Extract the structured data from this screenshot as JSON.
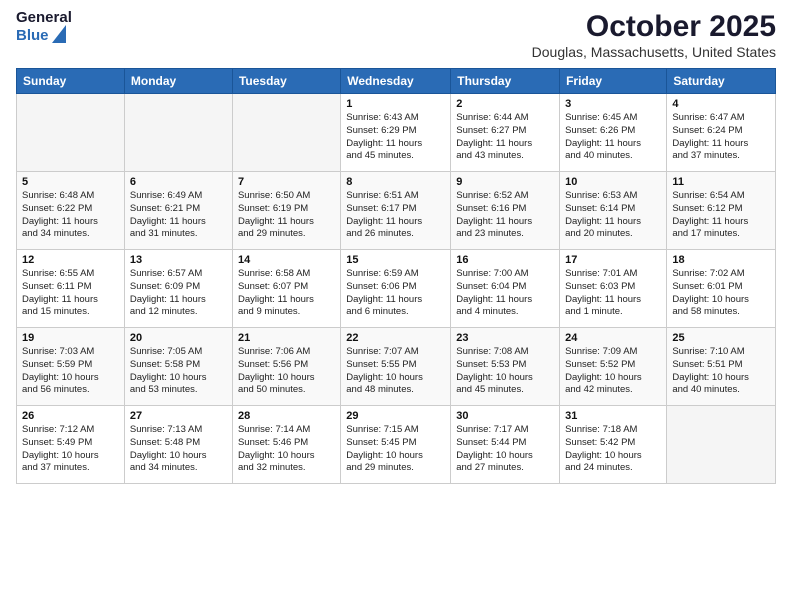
{
  "header": {
    "logo": {
      "general": "General",
      "blue": "Blue"
    },
    "title": "October 2025",
    "subtitle": "Douglas, Massachusetts, United States"
  },
  "weekdays": [
    "Sunday",
    "Monday",
    "Tuesday",
    "Wednesday",
    "Thursday",
    "Friday",
    "Saturday"
  ],
  "weeks": [
    [
      {
        "day": "",
        "info": ""
      },
      {
        "day": "",
        "info": ""
      },
      {
        "day": "",
        "info": ""
      },
      {
        "day": "1",
        "info": "Sunrise: 6:43 AM\nSunset: 6:29 PM\nDaylight: 11 hours\nand 45 minutes."
      },
      {
        "day": "2",
        "info": "Sunrise: 6:44 AM\nSunset: 6:27 PM\nDaylight: 11 hours\nand 43 minutes."
      },
      {
        "day": "3",
        "info": "Sunrise: 6:45 AM\nSunset: 6:26 PM\nDaylight: 11 hours\nand 40 minutes."
      },
      {
        "day": "4",
        "info": "Sunrise: 6:47 AM\nSunset: 6:24 PM\nDaylight: 11 hours\nand 37 minutes."
      }
    ],
    [
      {
        "day": "5",
        "info": "Sunrise: 6:48 AM\nSunset: 6:22 PM\nDaylight: 11 hours\nand 34 minutes."
      },
      {
        "day": "6",
        "info": "Sunrise: 6:49 AM\nSunset: 6:21 PM\nDaylight: 11 hours\nand 31 minutes."
      },
      {
        "day": "7",
        "info": "Sunrise: 6:50 AM\nSunset: 6:19 PM\nDaylight: 11 hours\nand 29 minutes."
      },
      {
        "day": "8",
        "info": "Sunrise: 6:51 AM\nSunset: 6:17 PM\nDaylight: 11 hours\nand 26 minutes."
      },
      {
        "day": "9",
        "info": "Sunrise: 6:52 AM\nSunset: 6:16 PM\nDaylight: 11 hours\nand 23 minutes."
      },
      {
        "day": "10",
        "info": "Sunrise: 6:53 AM\nSunset: 6:14 PM\nDaylight: 11 hours\nand 20 minutes."
      },
      {
        "day": "11",
        "info": "Sunrise: 6:54 AM\nSunset: 6:12 PM\nDaylight: 11 hours\nand 17 minutes."
      }
    ],
    [
      {
        "day": "12",
        "info": "Sunrise: 6:55 AM\nSunset: 6:11 PM\nDaylight: 11 hours\nand 15 minutes."
      },
      {
        "day": "13",
        "info": "Sunrise: 6:57 AM\nSunset: 6:09 PM\nDaylight: 11 hours\nand 12 minutes."
      },
      {
        "day": "14",
        "info": "Sunrise: 6:58 AM\nSunset: 6:07 PM\nDaylight: 11 hours\nand 9 minutes."
      },
      {
        "day": "15",
        "info": "Sunrise: 6:59 AM\nSunset: 6:06 PM\nDaylight: 11 hours\nand 6 minutes."
      },
      {
        "day": "16",
        "info": "Sunrise: 7:00 AM\nSunset: 6:04 PM\nDaylight: 11 hours\nand 4 minutes."
      },
      {
        "day": "17",
        "info": "Sunrise: 7:01 AM\nSunset: 6:03 PM\nDaylight: 11 hours\nand 1 minute."
      },
      {
        "day": "18",
        "info": "Sunrise: 7:02 AM\nSunset: 6:01 PM\nDaylight: 10 hours\nand 58 minutes."
      }
    ],
    [
      {
        "day": "19",
        "info": "Sunrise: 7:03 AM\nSunset: 5:59 PM\nDaylight: 10 hours\nand 56 minutes."
      },
      {
        "day": "20",
        "info": "Sunrise: 7:05 AM\nSunset: 5:58 PM\nDaylight: 10 hours\nand 53 minutes."
      },
      {
        "day": "21",
        "info": "Sunrise: 7:06 AM\nSunset: 5:56 PM\nDaylight: 10 hours\nand 50 minutes."
      },
      {
        "day": "22",
        "info": "Sunrise: 7:07 AM\nSunset: 5:55 PM\nDaylight: 10 hours\nand 48 minutes."
      },
      {
        "day": "23",
        "info": "Sunrise: 7:08 AM\nSunset: 5:53 PM\nDaylight: 10 hours\nand 45 minutes."
      },
      {
        "day": "24",
        "info": "Sunrise: 7:09 AM\nSunset: 5:52 PM\nDaylight: 10 hours\nand 42 minutes."
      },
      {
        "day": "25",
        "info": "Sunrise: 7:10 AM\nSunset: 5:51 PM\nDaylight: 10 hours\nand 40 minutes."
      }
    ],
    [
      {
        "day": "26",
        "info": "Sunrise: 7:12 AM\nSunset: 5:49 PM\nDaylight: 10 hours\nand 37 minutes."
      },
      {
        "day": "27",
        "info": "Sunrise: 7:13 AM\nSunset: 5:48 PM\nDaylight: 10 hours\nand 34 minutes."
      },
      {
        "day": "28",
        "info": "Sunrise: 7:14 AM\nSunset: 5:46 PM\nDaylight: 10 hours\nand 32 minutes."
      },
      {
        "day": "29",
        "info": "Sunrise: 7:15 AM\nSunset: 5:45 PM\nDaylight: 10 hours\nand 29 minutes."
      },
      {
        "day": "30",
        "info": "Sunrise: 7:17 AM\nSunset: 5:44 PM\nDaylight: 10 hours\nand 27 minutes."
      },
      {
        "day": "31",
        "info": "Sunrise: 7:18 AM\nSunset: 5:42 PM\nDaylight: 10 hours\nand 24 minutes."
      },
      {
        "day": "",
        "info": ""
      }
    ]
  ]
}
